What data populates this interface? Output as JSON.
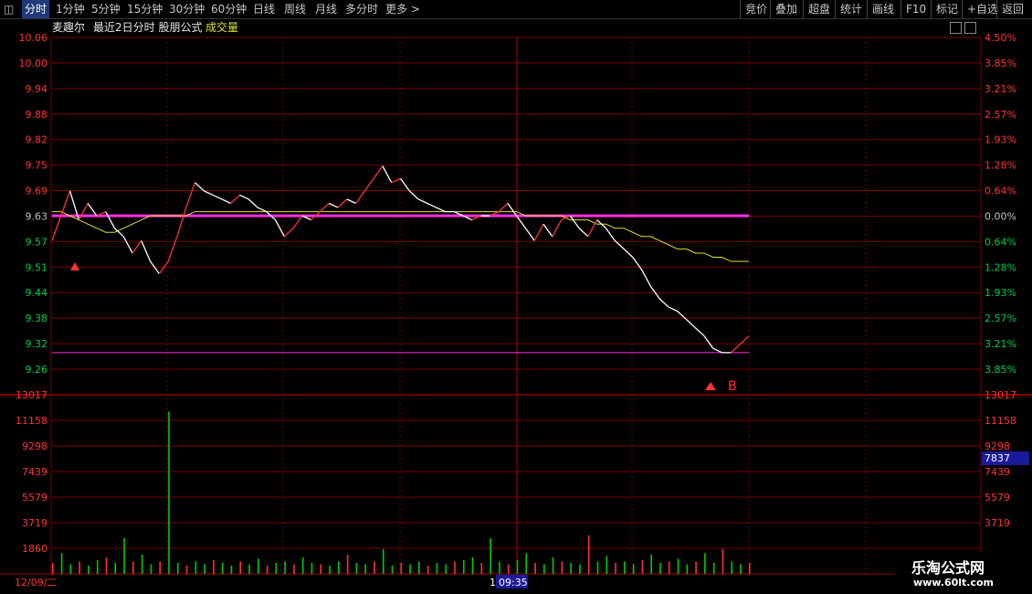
{
  "toolbar": {
    "tabs": [
      "分时",
      "1分钟",
      "5分钟",
      "15分钟",
      "30分钟",
      "60分钟",
      "日线",
      "周线",
      "月线",
      "多分时",
      "更多 >"
    ],
    "right": [
      "竞价",
      "叠加",
      "超盘",
      "统计",
      "画线",
      "F10",
      "标记",
      "+自选",
      "返回"
    ]
  },
  "subheader": {
    "stock": "麦趣尔",
    "title": "最近2日分时 股朋公式",
    "volume_label": "成交量"
  },
  "price_axis": {
    "left": [
      "10.06",
      "10.00",
      "9.94",
      "9.88",
      "9.82",
      "9.75",
      "9.69",
      "9.63",
      "9.57",
      "9.51",
      "9.44",
      "9.38",
      "9.32",
      "9.26"
    ],
    "right": [
      "4.50%",
      "3.85%",
      "3.21%",
      "2.57%",
      "1.93%",
      "1.28%",
      "0.64%",
      "0.00%",
      "0.64%",
      "1.28%",
      "1.93%",
      "2.57%",
      "3.21%",
      "3.85%"
    ]
  },
  "volume_axis": {
    "left": [
      "13017",
      "11158",
      "9298",
      "7439",
      "5579",
      "3719",
      "1860"
    ],
    "right": [
      "13017",
      "11158",
      "9298",
      "7439",
      "5579",
      "3719"
    ],
    "current": "7837"
  },
  "dates": {
    "day1": "12/09/二",
    "cursor_time": "09:35",
    "cursor_prefix": "1"
  },
  "signals": {
    "b_label": "B"
  },
  "watermark": {
    "line1": "乐淘公式网",
    "line2": "www.60lt.com"
  },
  "colors": {
    "up": "#ff3333",
    "price_line": "#ffffff",
    "avg_line": "#e0e030",
    "base_line": "#ff2ee0",
    "grid": "#7a0000",
    "volume": "#00cc00"
  },
  "chart_data": {
    "type": "line",
    "ylim": [
      9.26,
      10.06
    ],
    "prev_close": 9.63,
    "price": [
      9.57,
      9.63,
      9.69,
      9.62,
      9.66,
      9.63,
      9.64,
      9.6,
      9.58,
      9.54,
      9.57,
      9.52,
      9.49,
      9.52,
      9.58,
      9.65,
      9.71,
      9.69,
      9.68,
      9.67,
      9.66,
      9.68,
      9.67,
      9.65,
      9.64,
      9.62,
      9.58,
      9.6,
      9.63,
      9.62,
      9.64,
      9.66,
      9.65,
      9.67,
      9.66,
      9.69,
      9.72,
      9.75,
      9.71,
      9.72,
      9.69,
      9.67,
      9.66,
      9.65,
      9.64,
      9.64,
      9.63,
      9.62,
      9.63,
      9.63,
      9.64,
      9.66,
      9.63,
      9.6,
      9.57,
      9.61,
      9.58,
      9.62,
      9.63,
      9.6,
      9.58,
      9.62,
      9.6,
      9.57,
      9.55,
      9.53,
      9.5,
      9.46,
      9.43,
      9.41,
      9.4,
      9.38,
      9.36,
      9.34,
      9.31,
      9.3,
      9.3,
      9.32,
      9.34
    ],
    "avg": [
      9.64,
      9.64,
      9.63,
      9.62,
      9.61,
      9.6,
      9.59,
      9.59,
      9.6,
      9.61,
      9.62,
      9.63,
      9.63,
      9.63,
      9.63,
      9.63,
      9.64,
      9.64,
      9.64,
      9.64,
      9.64,
      9.64,
      9.64,
      9.64,
      9.64,
      9.64,
      9.64,
      9.64,
      9.64,
      9.64,
      9.64,
      9.64,
      9.64,
      9.64,
      9.64,
      9.64,
      9.64,
      9.64,
      9.64,
      9.64,
      9.64,
      9.64,
      9.64,
      9.64,
      9.64,
      9.64,
      9.64,
      9.64,
      9.64,
      9.64,
      9.64,
      9.64,
      9.64,
      9.63,
      9.63,
      9.63,
      9.63,
      9.63,
      9.62,
      9.62,
      9.62,
      9.61,
      9.61,
      9.6,
      9.6,
      9.59,
      9.58,
      9.58,
      9.57,
      9.56,
      9.55,
      9.55,
      9.54,
      9.54,
      9.53,
      9.53,
      9.52,
      9.52,
      9.52
    ],
    "support": 9.3,
    "volume_ylim": [
      0,
      13017
    ],
    "volume_spike": 11800,
    "volume": [
      800,
      1500,
      700,
      900,
      600,
      1000,
      1200,
      800,
      2600,
      900,
      1400,
      700,
      900,
      11800,
      800,
      600,
      900,
      700,
      1000,
      800,
      600,
      900,
      700,
      1100,
      600,
      800,
      900,
      700,
      1200,
      800,
      700,
      600,
      900,
      1400,
      800,
      700,
      900,
      1800,
      600,
      800,
      700,
      900,
      600,
      800,
      700,
      900,
      1000,
      1200,
      800,
      2600,
      900,
      700,
      1000,
      1500,
      800,
      700,
      1200,
      900,
      800,
      700,
      2800,
      900,
      1300,
      800,
      900,
      700,
      1000,
      1400,
      800,
      900,
      1100,
      700,
      900,
      1500,
      800,
      1800,
      900,
      700,
      800
    ]
  }
}
